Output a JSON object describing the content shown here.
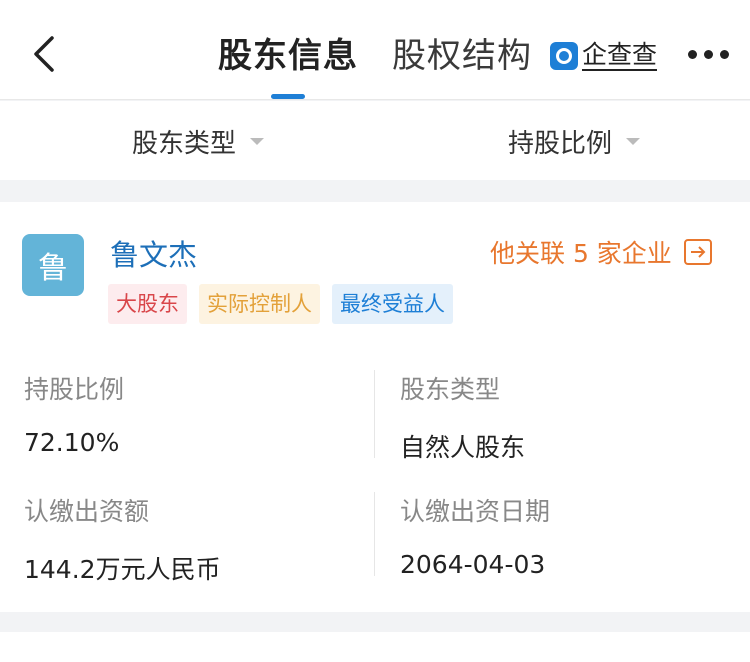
{
  "header": {
    "tabs": [
      {
        "label": "股东信息",
        "active": true
      },
      {
        "label": "股权结构",
        "active": false
      }
    ],
    "brand": "企查查",
    "accent_color": "#1e7fd6"
  },
  "filters": {
    "type_label": "股东类型",
    "ratio_label": "持股比例"
  },
  "shareholder": {
    "avatar_char": "鲁",
    "name": "鲁文杰",
    "related_text": "他关联 5 家企业",
    "tags": [
      "大股东",
      "实际控制人",
      "最终受益人"
    ],
    "fields": [
      {
        "label": "持股比例",
        "value": "72.10%"
      },
      {
        "label": "股东类型",
        "value": "自然人股东"
      },
      {
        "label": "认缴出资额",
        "value": "144.2万元人民币"
      },
      {
        "label": "认缴出资日期",
        "value": "2064-04-03"
      }
    ]
  },
  "icons": [
    "back-icon",
    "brand-logo-icon",
    "more-icon",
    "dropdown-caret-icon",
    "external-arrow-icon"
  ]
}
